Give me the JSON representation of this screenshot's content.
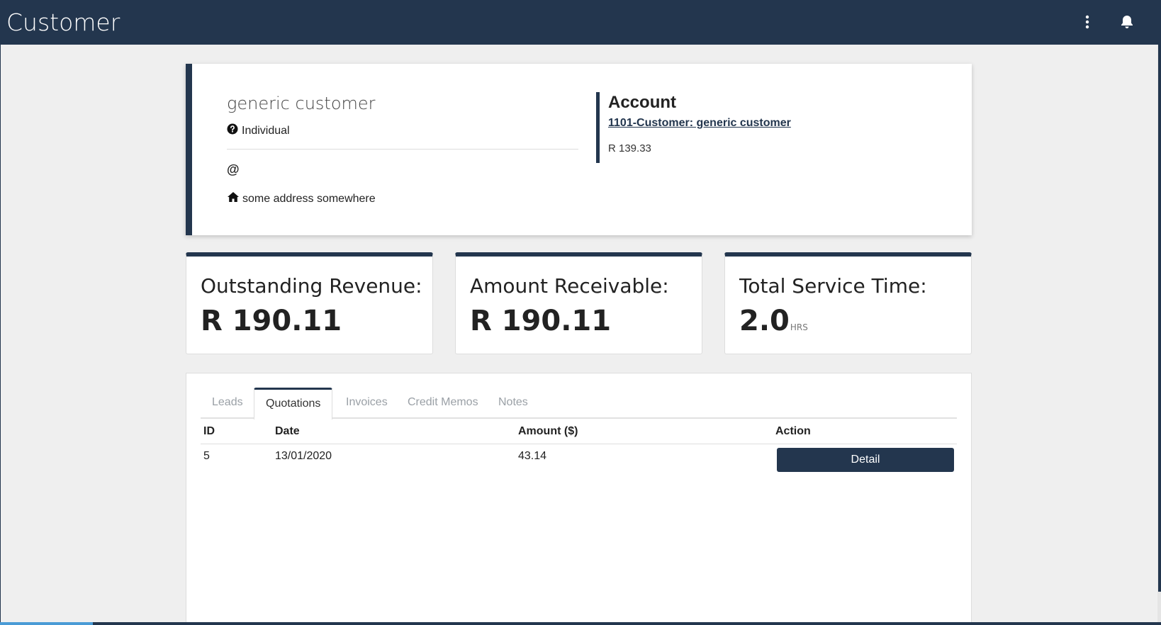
{
  "header": {
    "title": "Customer",
    "menu_icon": "kebab-icon",
    "notif_icon": "bell-icon"
  },
  "customer": {
    "name": "generic customer",
    "type": "Individual",
    "email": "@",
    "address": "some address somewhere"
  },
  "account": {
    "title": "Account",
    "link": "1101-Customer: generic customer",
    "balance": "R 139.33"
  },
  "stats": [
    {
      "label": "Outstanding Revenue:",
      "value": "R 190.11",
      "unit": ""
    },
    {
      "label": "Amount Receivable:",
      "value": "R 190.11",
      "unit": ""
    },
    {
      "label": "Total Service Time:",
      "value": "2.0",
      "unit": "HRS"
    }
  ],
  "tabs": [
    {
      "label": "Leads"
    },
    {
      "label": "Quotations",
      "active": true
    },
    {
      "label": "Invoices"
    },
    {
      "label": "Credit Memos"
    },
    {
      "label": "Notes"
    }
  ],
  "table": {
    "columns": [
      "ID",
      "Date",
      "Amount ($)",
      "Action"
    ],
    "rows": [
      {
        "id": "5",
        "date": "13/01/2020",
        "amount": "43.14",
        "action": "Detail"
      }
    ]
  },
  "colors": {
    "primary": "#23364e",
    "accent": "#4a9bd6"
  },
  "page_progress": 0.08
}
